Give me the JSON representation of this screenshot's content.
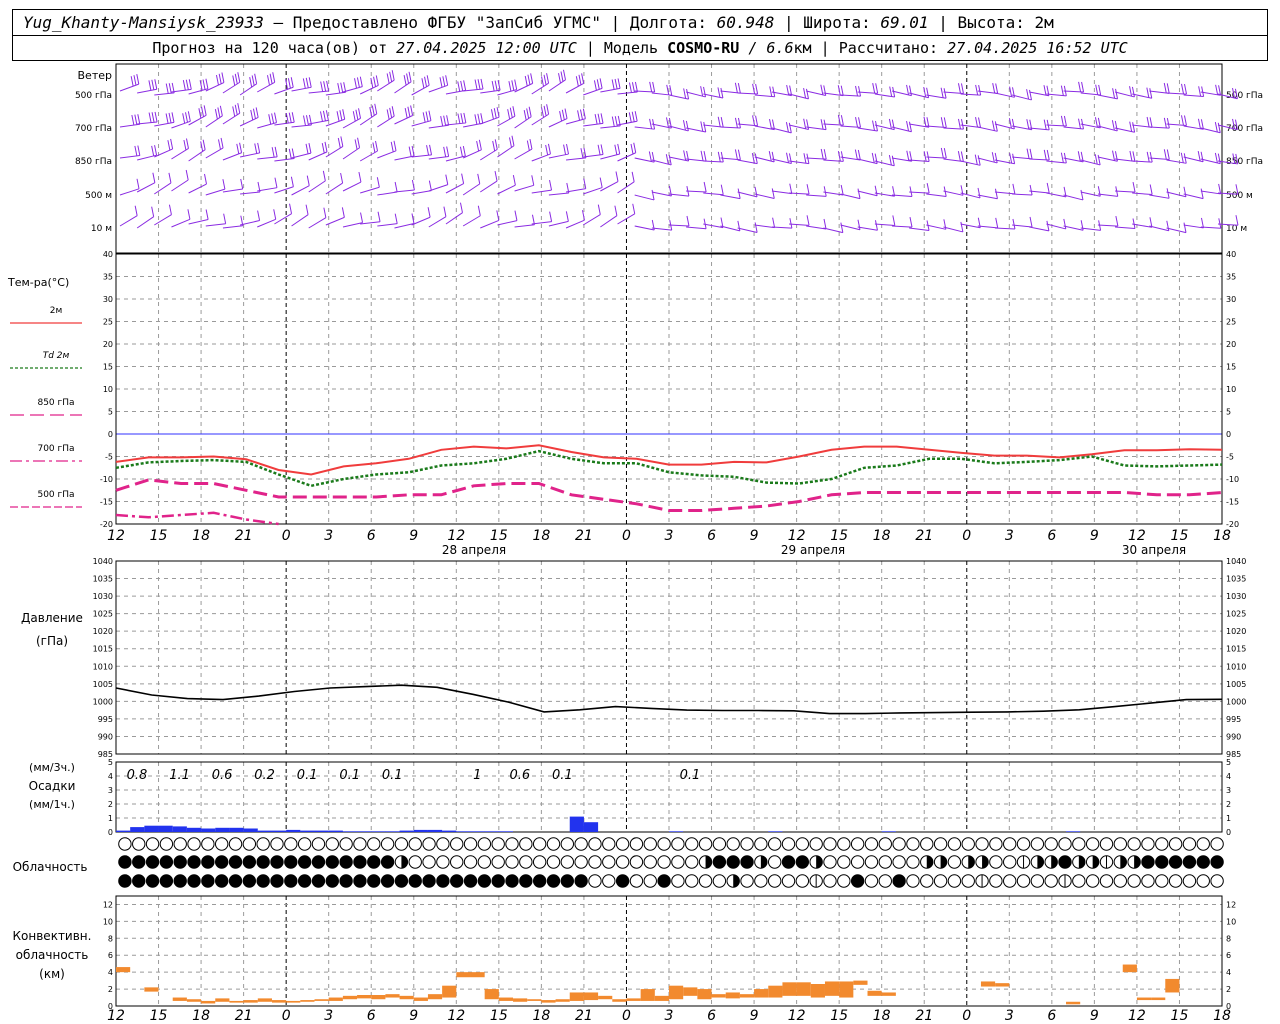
{
  "header": {
    "station": "Yug_Khanty-Mansiysk_23933",
    "provider": "— Предоставлено ФГБУ \"ЗапСиб УГМС\"",
    "lon_label": "Долгота:",
    "lon_value": "60.948",
    "lat_label": "Широта:",
    "lat_value": "69.01",
    "alt_label": "Высота:",
    "alt_value": "2м",
    "forecast_prefix": "Прогноз на 120 часа(ов) от",
    "forecast_start": "27.04.2025 12:00 UTC",
    "model_label": "Модель",
    "model_name": "COSMO-RU",
    "model_res": "/ 6.6",
    "model_res_unit": "км",
    "calc_label": "Рассчитано:",
    "calc_time": "27.04.2025 16:52 UTC"
  },
  "chart_data": [
    {
      "type": "line",
      "title": "",
      "panel": "wind",
      "ylabel": "Ветер",
      "levels": [
        "500 гПа",
        "700 гПа",
        "850 гПа",
        "500 м",
        "10  м"
      ]
    },
    {
      "type": "line",
      "panel": "temperature",
      "ylabel": "Тем-ра(°C)",
      "ylim": [
        -20,
        40
      ],
      "yticks": [
        40,
        35,
        30,
        25,
        20,
        15,
        10,
        5,
        0,
        -5,
        -10,
        -15,
        -20
      ],
      "x_hours": [
        "12",
        "15",
        "18",
        "21",
        "0",
        "3",
        "6",
        "9",
        "12",
        "15",
        "18",
        "21",
        "0",
        "3",
        "6",
        "9",
        "12",
        "15",
        "18",
        "21",
        "0",
        "3",
        "6",
        "9",
        "12",
        "15",
        "18"
      ],
      "date_labels": [
        "28 апреля",
        "29 апреля",
        "30 апреля"
      ],
      "series": [
        {
          "name": "2м",
          "color": "#f03c3c",
          "values": [
            -6.2,
            -5.2,
            -5.2,
            -5.0,
            -5.6,
            -8.0,
            -9.0,
            -7.2,
            -6.5,
            -5.5,
            -3.5,
            -2.8,
            -3.2,
            -2.5,
            -4.0,
            -5.2,
            -5.5,
            -6.8,
            -6.8,
            -6.2,
            -6.3,
            -5.0,
            -3.5,
            -2.8,
            -2.8,
            -3.5,
            -4.2,
            -4.8,
            -4.8,
            -5.2,
            -4.5,
            -3.6,
            -3.6,
            -3.4,
            -3.5
          ]
        },
        {
          "name": "Td 2м",
          "color": "#1a7a1a",
          "values": [
            -7.5,
            -6.3,
            -6.0,
            -5.8,
            -6.2,
            -9.0,
            -11.5,
            -10.0,
            -9.0,
            -8.5,
            -7.0,
            -6.5,
            -5.5,
            -3.8,
            -5.5,
            -6.5,
            -6.5,
            -8.5,
            -9.2,
            -9.5,
            -10.8,
            -11.0,
            -10.0,
            -7.5,
            -7.0,
            -5.5,
            -5.5,
            -6.5,
            -6.2,
            -5.8,
            -5.0,
            -7.0,
            -7.2,
            -7.0,
            -6.8
          ]
        },
        {
          "name": "850 гПа",
          "color": "#e0238a",
          "values": [
            -12.5,
            -10.2,
            -11.0,
            -11.0,
            -12.5,
            -14.0,
            -14.0,
            -14.0,
            -14.0,
            -13.5,
            -13.5,
            -11.5,
            -11.0,
            -11.0,
            -13.5,
            -14.5,
            -15.5,
            -17.0,
            -17.0,
            -16.5,
            -16.0,
            -15.0,
            -13.5,
            -13.0,
            -13.0,
            -13.0,
            -13.0,
            -13.0,
            -13.0,
            -13.0,
            -13.0,
            -13.0,
            -13.5,
            -13.5,
            -13.0
          ]
        },
        {
          "name": "700 гПа",
          "color": "#e0238a",
          "values": [
            -18.0,
            -18.5,
            -18.0,
            -17.5,
            -19.0,
            -20.0
          ]
        },
        {
          "name": "500 гПа",
          "color": "#e0238a",
          "values": []
        }
      ]
    },
    {
      "type": "line",
      "panel": "pressure",
      "ylabel": "Давление",
      "yunit": "(гПа)",
      "ylim": [
        985,
        1040
      ],
      "yticks": [
        1040,
        1035,
        1030,
        1025,
        1020,
        1015,
        1010,
        1005,
        1000,
        995,
        990,
        985
      ],
      "series": [
        {
          "name": "",
          "color": "#000000",
          "values": [
            1003.8,
            1001.8,
            1000.8,
            1000.5,
            1001.5,
            1002.8,
            1003.8,
            1004.2,
            1004.6,
            1004.0,
            1002.0,
            999.8,
            997.0,
            997.6,
            998.5,
            998.0,
            997.5,
            997.4,
            997.4,
            997.3,
            996.5,
            996.5,
            996.7,
            996.8,
            996.9,
            997.0,
            997.2,
            997.6,
            998.5,
            999.5,
            1000.5,
            1000.6
          ]
        }
      ]
    },
    {
      "type": "bar",
      "panel": "precipitation",
      "ylabel": "Осадки",
      "yunit_top": "(мм/3ч.)",
      "yunit_bottom": "(мм/1ч.)",
      "ylim": [
        0,
        5
      ],
      "yticks": [
        5,
        4,
        3,
        2,
        1,
        0
      ],
      "labels_3h": [
        "0.8",
        "1.1",
        "0.6",
        "0.2",
        "0.1",
        "0.1",
        "0.1",
        "",
        "1",
        "0.6",
        "0.1",
        "",
        "",
        "0.1"
      ],
      "values_1h": [
        0.1,
        0.35,
        0.45,
        0.45,
        0.4,
        0.3,
        0.25,
        0.3,
        0.3,
        0.25,
        0.1,
        0.1,
        0.15,
        0.1,
        0.1,
        0.1,
        0.05,
        0.05,
        0.05,
        0.05,
        0.1,
        0.15,
        0.15,
        0.1,
        0.05,
        0.05,
        0.05,
        0.05,
        0,
        0,
        0,
        0,
        1.1,
        0.7,
        0,
        0,
        0,
        0,
        0,
        0.05,
        0,
        0,
        0,
        0,
        0,
        0,
        0.05,
        0,
        0,
        0,
        0,
        0,
        0,
        0,
        0.05,
        0,
        0,
        0,
        0,
        0,
        0,
        0,
        0,
        0,
        0,
        0,
        0,
        0.05
      ]
    },
    {
      "type": "table",
      "panel": "cloudiness",
      "ylabel": "Облачность",
      "rows": [
        "oooooooooooooooooooooooooooooooooooooooooooooooooooooooooooooooooooooooooooooooooooooooooooooooo",
        "ffffffffffffffffffffhooooooooooooooooooooohfffhoffhooooooohhohhooqhhfhhqhhffffffffffffffffffhhhhhhhhooohhhhhhhhhhhfffff",
        "ffffffffffffffffffffffffffffffffffoofoofoooohoooooqoofoofoooooqoooooqooooooooooooooooooooooooooooooooooooooohhhhhhhhhhh"
      ]
    },
    {
      "type": "bar",
      "panel": "convective",
      "ylabel": "Конвективн. облачность (км)",
      "ylabel_lines": [
        "Конвективн.",
        "облачность",
        "(км)"
      ],
      "ylim": [
        0,
        13
      ],
      "yticks": [
        12,
        10,
        8,
        6,
        4,
        2,
        0
      ],
      "bars": [
        [
          0,
          1,
          4.0,
          4.6
        ],
        [
          2,
          3,
          1.7,
          2.2
        ],
        [
          4,
          5,
          0.6,
          1.0
        ],
        [
          5,
          6,
          0.5,
          0.8
        ],
        [
          6,
          7,
          0.3,
          0.6
        ],
        [
          7,
          8,
          0.5,
          0.9
        ],
        [
          8,
          9,
          0.4,
          0.6
        ],
        [
          9,
          10,
          0.4,
          0.7
        ],
        [
          10,
          11,
          0.5,
          0.9
        ],
        [
          11,
          12,
          0.4,
          0.7
        ],
        [
          12,
          13,
          0.4,
          0.6
        ],
        [
          13,
          14,
          0.5,
          0.7
        ],
        [
          14,
          15,
          0.6,
          0.8
        ],
        [
          15,
          16,
          0.6,
          1.0
        ],
        [
          16,
          17,
          0.8,
          1.2
        ],
        [
          17,
          18,
          0.9,
          1.3
        ],
        [
          18,
          19,
          0.8,
          1.3
        ],
        [
          19,
          20,
          1.0,
          1.4
        ],
        [
          20,
          21,
          0.8,
          1.2
        ],
        [
          21,
          22,
          0.6,
          1.0
        ],
        [
          22,
          23,
          0.8,
          1.4
        ],
        [
          23,
          24,
          1.0,
          2.4
        ],
        [
          24,
          25,
          3.4,
          4.0
        ],
        [
          25,
          26,
          3.4,
          4.0
        ],
        [
          26,
          27,
          0.8,
          2.0
        ],
        [
          27,
          28,
          0.6,
          1.0
        ],
        [
          28,
          29,
          0.5,
          0.9
        ],
        [
          29,
          30,
          0.6,
          0.8
        ],
        [
          30,
          31,
          0.4,
          0.7
        ],
        [
          31,
          32,
          0.5,
          0.8
        ],
        [
          32,
          33,
          0.6,
          1.6
        ],
        [
          33,
          34,
          0.7,
          1.6
        ],
        [
          34,
          35,
          0.8,
          1.2
        ],
        [
          35,
          36,
          0.5,
          0.8
        ],
        [
          36,
          37,
          0.6,
          0.9
        ],
        [
          37,
          38,
          0.6,
          2.0
        ],
        [
          38,
          39,
          0.6,
          1.2
        ],
        [
          39,
          40,
          0.8,
          2.4
        ],
        [
          40,
          41,
          1.2,
          2.2
        ],
        [
          41,
          42,
          0.8,
          2.0
        ],
        [
          42,
          43,
          1.0,
          1.4
        ],
        [
          43,
          44,
          0.9,
          1.6
        ],
        [
          44,
          45,
          1.0,
          1.4
        ],
        [
          45,
          46,
          1.0,
          2.0
        ],
        [
          46,
          47,
          1.0,
          2.4
        ],
        [
          47,
          48,
          1.2,
          2.8
        ],
        [
          48,
          49,
          1.2,
          2.8
        ],
        [
          49,
          50,
          1.0,
          2.6
        ],
        [
          50,
          51,
          1.2,
          2.9
        ],
        [
          51,
          52,
          1.0,
          2.9
        ],
        [
          52,
          53,
          2.5,
          3.0
        ],
        [
          53,
          54,
          1.2,
          1.8
        ],
        [
          54,
          55,
          1.2,
          1.6
        ],
        [
          61,
          62,
          2.3,
          2.9
        ],
        [
          62,
          63,
          2.3,
          2.7
        ],
        [
          67,
          68,
          0.2,
          0.5
        ],
        [
          71,
          72,
          4.0,
          4.9
        ],
        [
          72,
          73,
          0.7,
          1.0
        ],
        [
          73,
          74,
          0.7,
          1.0
        ],
        [
          74,
          75,
          1.6,
          3.2
        ]
      ]
    }
  ]
}
